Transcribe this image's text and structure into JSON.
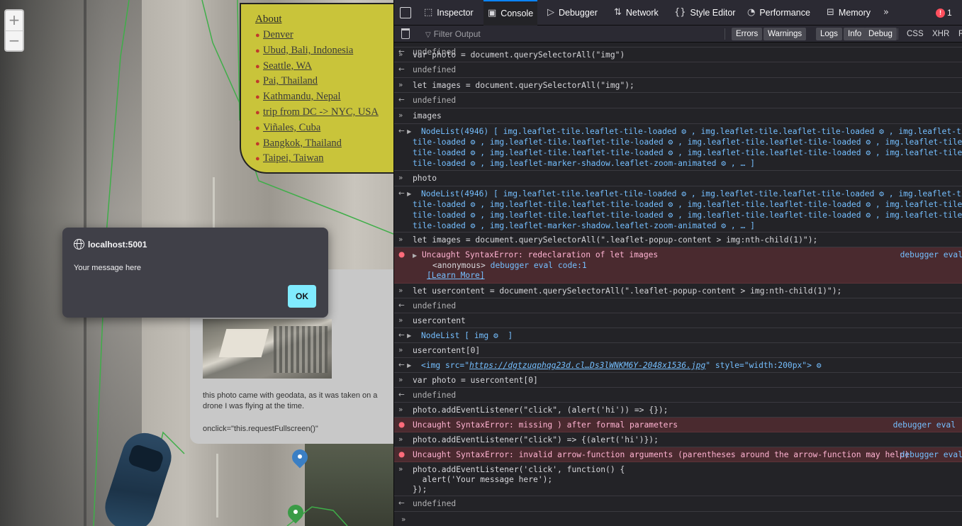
{
  "map": {
    "zoom_in": "+",
    "zoom_out": "−",
    "locations_title": "About",
    "locations": [
      "Denver",
      "Ubud, Bali, Indonesia",
      "Seattle, WA",
      "Pai, Thailand",
      "Kathmandu, Nepal",
      "trip from DC -> NYC, USA",
      "Viñales, Cuba",
      "Bangkok, Thailand",
      "Taipei, Taiwan"
    ],
    "popup_caption": "this photo came with geodata, as it was taken on a drone I was flying at the time.",
    "popup_onclick": "onclick=\"this.requestFullscreen()\"",
    "marker_colors": [
      "#3b7fc4",
      "#3a9b46"
    ]
  },
  "alert": {
    "origin": "localhost:5001",
    "message": "Your message here",
    "ok_label": "OK"
  },
  "devtools": {
    "tabs": [
      {
        "label": "Inspector",
        "icon": "inspector-icon"
      },
      {
        "label": "Console",
        "icon": "console-icon"
      },
      {
        "label": "Debugger",
        "icon": "debugger-icon"
      },
      {
        "label": "Network",
        "icon": "network-icon"
      },
      {
        "label": "Style Editor",
        "icon": "style-editor-icon"
      },
      {
        "label": "Performance",
        "icon": "performance-icon"
      },
      {
        "label": "Memory",
        "icon": "memory-icon"
      }
    ],
    "error_count": "1",
    "filter_placeholder": "Filter Output",
    "filters": [
      "Errors",
      "Warnings",
      "Logs",
      "Info",
      "Debug"
    ],
    "request_filters": [
      "CSS",
      "XHR",
      "R"
    ],
    "accent": "#0a84ff",
    "console": {
      "top_partial": "undefined",
      "cmd_var_photo": "var photo = document.querySelectorAll(\"img\")",
      "undefined": "undefined",
      "cmd_let_images": "let images = document.querySelectorAll(\"img\");",
      "cmd_images": "images",
      "nodelist_line1": "NodeList(4946) [ img.leaflet-tile.leaflet-tile-loaded ⚙ , img.leaflet-tile.leaflet-tile-loaded ⚙ , img.leaflet-tile",
      "nodelist_line2": "tile-loaded ⚙ , img.leaflet-tile.leaflet-tile-loaded ⚙ , img.leaflet-tile.leaflet-tile-loaded ⚙ , img.leaflet-tile.l",
      "nodelist_line3": "tile-loaded ⚙ , img.leaflet-tile.leaflet-tile-loaded ⚙ , img.leaflet-tile.leaflet-tile-loaded ⚙ , img.leaflet-tile.l",
      "nodelist_line4": "tile-loaded ⚙ , img.leaflet-marker-shadow.leaflet-zoom-animated ⚙ , … ]",
      "cmd_photo": "photo",
      "cmd_let_images2": "let images = document.querySelectorAll(\".leaflet-popup-content > img:nth-child(1)\");",
      "err_redeclare": "Uncaught SyntaxError: redeclaration of let images",
      "err_anon": "<anonymous>",
      "err_anon_src": "debugger eval code:1",
      "learn_more": "[Learn More]",
      "src_debugger_eval": "debugger eval",
      "cmd_usercontent_assign": "let usercontent = document.querySelectorAll(\".leaflet-popup-content > img:nth-child(1)\");",
      "cmd_usercontent": "usercontent",
      "nodelist_short": "NodeList [ img ⚙  ]",
      "cmd_usercontent0": "usercontent[0]",
      "img_result_prefix": "<img src=\"",
      "img_result_url": "https://dgtzuqphqg23d.cl…Ds3lWNKM6Y-2048x1536.jpg",
      "img_result_suffix": "\" style=\"width:200px\"> ⚙",
      "cmd_var_photo2": "var photo = usercontent[0]",
      "cmd_addlistener1": "photo.addEventListener(\"click\", (alert('hi')) => {});",
      "err_missing_paren": "Uncaught SyntaxError: missing ) after formal parameters",
      "cmd_addlistener2": "photo.addEventListener(\"click\") => {(alert('hi')});",
      "err_arrow": "Uncaught SyntaxError: invalid arrow-function arguments (parentheses around the arrow-function may help)",
      "cmd_addlistener3_l1": "photo.addEventListener('click', function() {",
      "cmd_addlistener3_l2": "  alert('Your message here');",
      "cmd_addlistener3_l3": "});"
    }
  }
}
